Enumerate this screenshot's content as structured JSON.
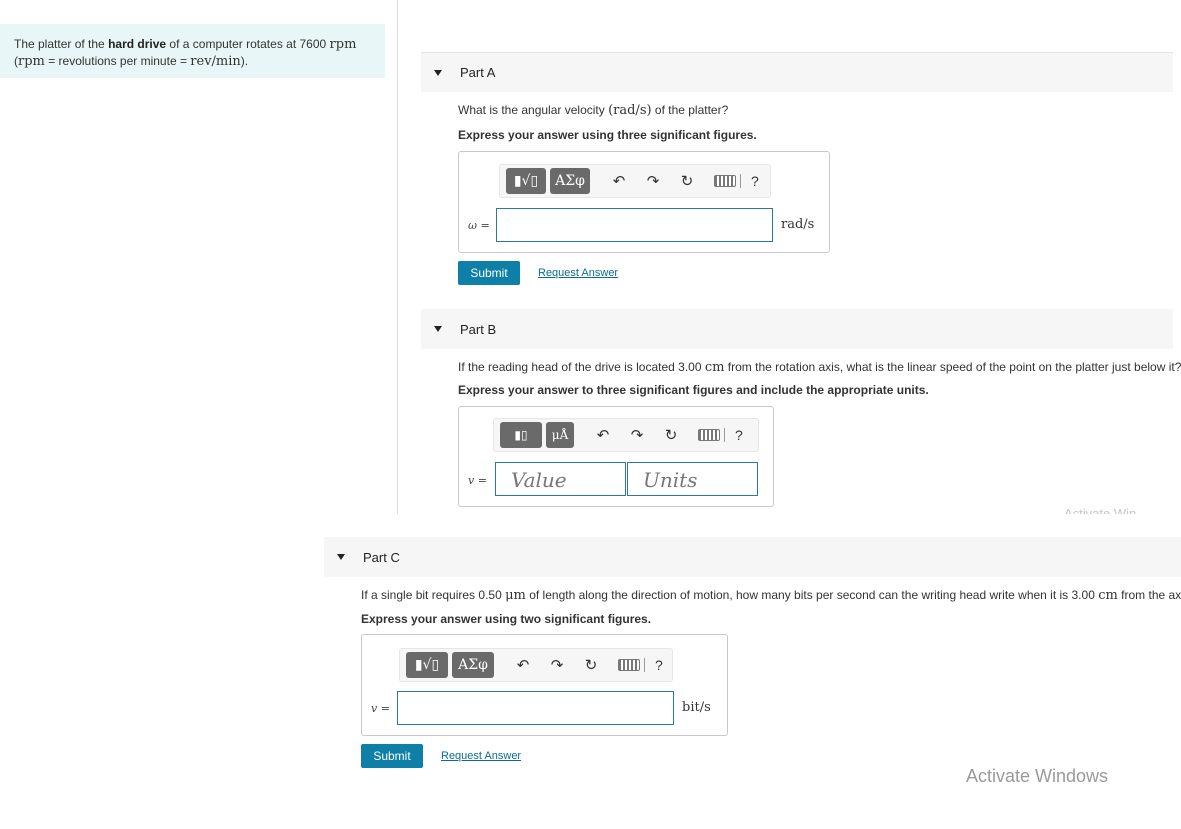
{
  "problem": {
    "text_1": "The platter of the ",
    "text_bold": "hard drive",
    "text_2": " of a computer rotates at 7600 ",
    "unit_rpm": "rpm",
    "line2_open": "(",
    "line2_rpm": "rpm",
    "line2_text": " = revolutions per minute = ",
    "line2_unit": "rev/min",
    "line2_close": ")."
  },
  "toolbar": {
    "template_btn": "▮√▯",
    "symbols_btn": "ΑΣφ",
    "units_template_btn": "▮▯",
    "units_btn": "μÅ",
    "undo": "↶",
    "redo": "↷",
    "reset": "↻",
    "help": "?"
  },
  "part_a": {
    "title": "Part A",
    "question_pre": "What is the angular velocity ",
    "question_unit": "(rad/s)",
    "question_post": " of the platter?",
    "instruction": "Express your answer using three significant figures.",
    "var_label": "ω =",
    "input_value": "",
    "unit": "rad/s",
    "submit": "Submit",
    "request": "Request Answer"
  },
  "part_b": {
    "title": "Part B",
    "question_pre": "If the reading head of the drive is located 3.00 ",
    "question_unit": "cm",
    "question_post": " from the rotation axis, what is the linear speed of the point on the platter just below it?",
    "instruction": "Express your answer to three significant figures and include the appropriate units.",
    "var_label": "v =",
    "value_placeholder": "Value",
    "units_placeholder": "Units"
  },
  "part_c": {
    "title": "Part C",
    "question_pre": "If a single bit requires 0.50 ",
    "question_unit": "μm",
    "question_mid": " of length along the direction of motion, how many bits per second can the writing head write when it is 3.00 ",
    "question_unit2": "cm",
    "question_post": " from the axis?",
    "instruction": "Express your answer using two significant figures.",
    "var_label": "v =",
    "input_value": "",
    "unit": "bit/s",
    "submit": "Submit",
    "request": "Request Answer"
  },
  "watermark": {
    "text": "Activate Windows",
    "partial_text": "Activate Win"
  }
}
